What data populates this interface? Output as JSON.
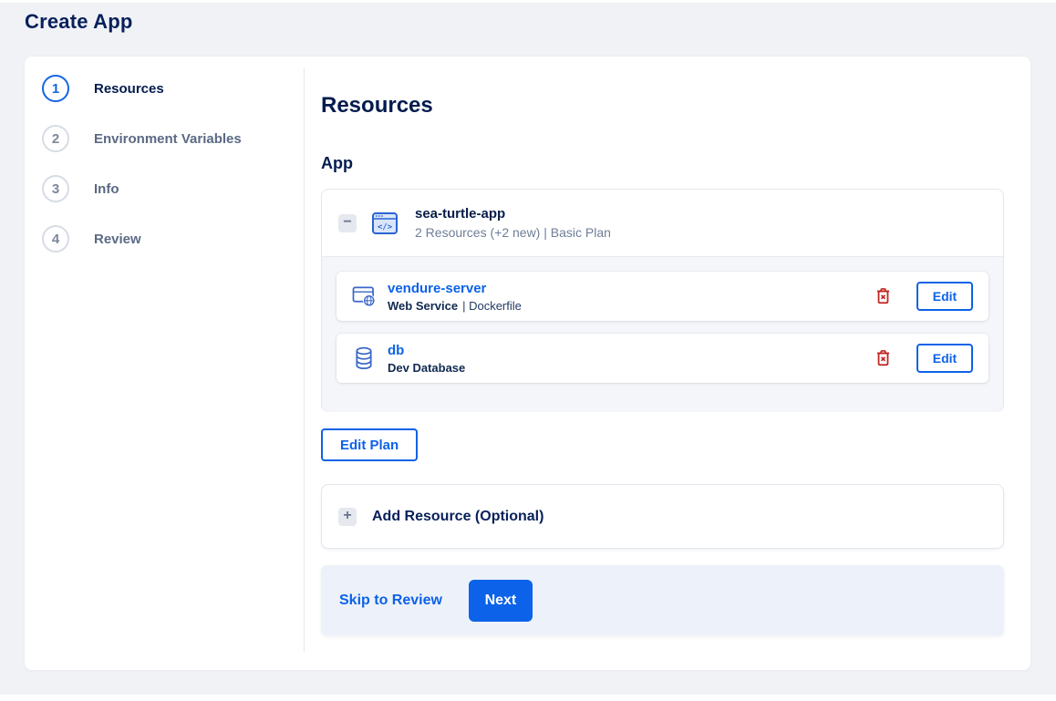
{
  "page": {
    "title": "Create App"
  },
  "stepper": {
    "active_step": 1,
    "steps": [
      {
        "number": "1",
        "label": "Resources"
      },
      {
        "number": "2",
        "label": "Environment Variables"
      },
      {
        "number": "3",
        "label": "Info"
      },
      {
        "number": "4",
        "label": "Review"
      }
    ]
  },
  "content": {
    "heading": "Resources",
    "section_label": "App",
    "app_card": {
      "collapse_glyph": "−",
      "icon": "app-code-icon",
      "name": "sea-turtle-app",
      "summary": "2 Resources (+2 new) | Basic Plan",
      "edit_button_label": "Edit",
      "resources": [
        {
          "name": "vendure-server",
          "type": "Web Service",
          "detail": "| Dockerfile",
          "icon": "web-service-icon"
        },
        {
          "name": "db",
          "type": "Dev Database",
          "detail": "",
          "icon": "database-icon"
        }
      ]
    },
    "edit_plan_button_label": "Edit Plan",
    "add_resource": {
      "plus_glyph": "+",
      "label": "Add Resource (Optional)"
    }
  },
  "footer": {
    "skip_link_label": "Skip to Review",
    "next_button_label": "Next"
  },
  "colors": {
    "accent_blue": "#0c62e8",
    "heading_navy": "#031b4e",
    "muted_text": "#6e7e98",
    "danger_red": "#c0241e",
    "page_background": "#f0f2f6",
    "footer_band": "#edf2fa"
  }
}
